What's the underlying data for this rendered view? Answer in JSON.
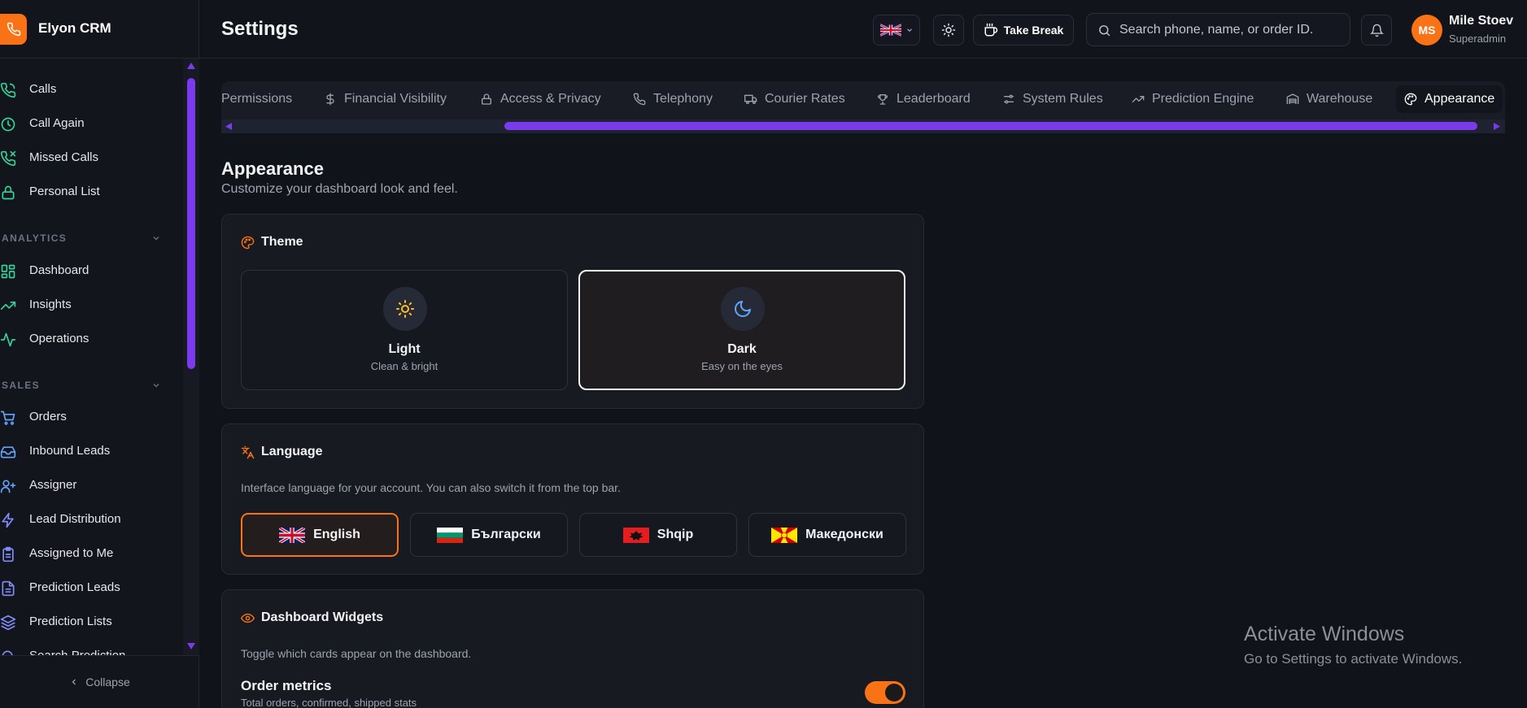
{
  "brand": {
    "name": "Elyon CRM"
  },
  "page": {
    "title": "Settings"
  },
  "topbar": {
    "language_flag": "gb-flag",
    "take_break_label": "Take Break",
    "search_placeholder": "Search phone, name, or order ID.",
    "user": {
      "initials": "MS",
      "name": "Mile Stoev",
      "role": "Superadmin"
    }
  },
  "sidebar": {
    "items_top": [
      {
        "label": "Calls",
        "icon": "phone-icon"
      },
      {
        "label": "Call Again",
        "icon": "clock-icon"
      },
      {
        "label": "Missed Calls",
        "icon": "phone-missed-icon"
      },
      {
        "label": "Personal List",
        "icon": "lock-icon"
      }
    ],
    "analytics": {
      "title": "ANALYTICS",
      "items": [
        {
          "label": "Dashboard",
          "icon": "grid-icon"
        },
        {
          "label": "Insights",
          "icon": "trend-icon"
        },
        {
          "label": "Operations",
          "icon": "activity-icon"
        }
      ]
    },
    "sales": {
      "title": "SALES",
      "items": [
        {
          "label": "Orders",
          "icon": "cart-icon"
        },
        {
          "label": "Inbound Leads",
          "icon": "inbox-icon"
        },
        {
          "label": "Assigner",
          "icon": "user-plus-icon"
        },
        {
          "label": "Lead Distribution",
          "icon": "bolt-icon"
        },
        {
          "label": "Assigned to Me",
          "icon": "clipboard-icon"
        },
        {
          "label": "Prediction Leads",
          "icon": "file-icon"
        },
        {
          "label": "Prediction Lists",
          "icon": "layers-icon"
        },
        {
          "label": "Search Prediction",
          "icon": "search-icon"
        }
      ]
    },
    "collapse_label": "Collapse"
  },
  "tabs": [
    {
      "label": "Permissions",
      "icon": ""
    },
    {
      "label": "Financial Visibility",
      "icon": "dollar-icon"
    },
    {
      "label": "Access & Privacy",
      "icon": "lock-icon"
    },
    {
      "label": "Telephony",
      "icon": "phone-icon"
    },
    {
      "label": "Courier Rates",
      "icon": "truck-icon"
    },
    {
      "label": "Leaderboard",
      "icon": "trophy-icon"
    },
    {
      "label": "System Rules",
      "icon": "sliders-icon"
    },
    {
      "label": "Prediction Engine",
      "icon": "trend-icon"
    },
    {
      "label": "Warehouse",
      "icon": "warehouse-icon"
    },
    {
      "label": "Appearance",
      "icon": "palette-icon",
      "active": true
    }
  ],
  "appearance": {
    "title": "Appearance",
    "subtitle": "Customize your dashboard look and feel.",
    "theme": {
      "title": "Theme",
      "options": [
        {
          "label": "Light",
          "desc": "Clean & bright",
          "icon": "sun-icon"
        },
        {
          "label": "Dark",
          "desc": "Easy on the eyes",
          "icon": "moon-icon",
          "selected": true
        }
      ]
    },
    "language": {
      "title": "Language",
      "note": "Interface language for your account. You can also switch it from the top bar.",
      "options": [
        {
          "label": "English",
          "flag": "gb-flag",
          "selected": true
        },
        {
          "label": "Български",
          "flag": "bg-flag"
        },
        {
          "label": "Shqip",
          "flag": "al-flag"
        },
        {
          "label": "Македонски",
          "flag": "mk-flag"
        }
      ]
    },
    "widgets": {
      "title": "Dashboard Widgets",
      "note": "Toggle which cards appear on the dashboard.",
      "items": [
        {
          "label": "Order metrics",
          "desc": "Total orders, confirmed, shipped stats",
          "enabled": true
        }
      ]
    }
  },
  "watermark": {
    "line1": "Activate Windows",
    "line2": "Go to Settings to activate Windows."
  },
  "colors": {
    "accent": "#f97316",
    "scrollbar": "#7c3aed",
    "background": "#11131a"
  }
}
